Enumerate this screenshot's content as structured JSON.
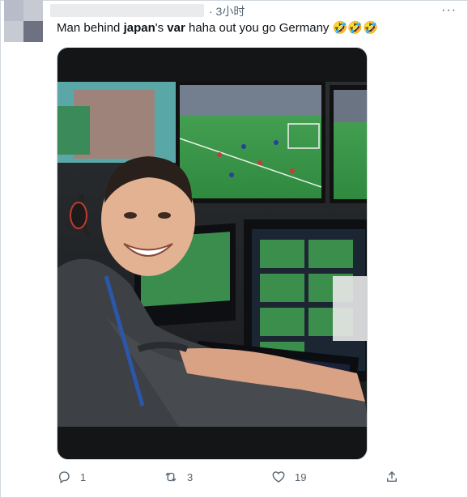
{
  "tweet": {
    "time": "· 3小时",
    "more_icon": "more-icon",
    "text_parts": {
      "p1": "Man behind ",
      "p2": "japan",
      "p3": "'s ",
      "p4": "var",
      "p5": " haha out you go Germany ",
      "emoji": "🤣🤣🤣"
    }
  },
  "actions": {
    "reply": {
      "icon": "reply-icon",
      "count": "1"
    },
    "retweet": {
      "icon": "retweet-icon",
      "count": "3"
    },
    "like": {
      "icon": "heart-icon",
      "count": "19"
    },
    "share": {
      "icon": "share-icon"
    }
  },
  "colors": {
    "text": "#0f1419",
    "muted": "#536471",
    "border": "#cfd9de",
    "pitch": "#3f9a4e"
  }
}
